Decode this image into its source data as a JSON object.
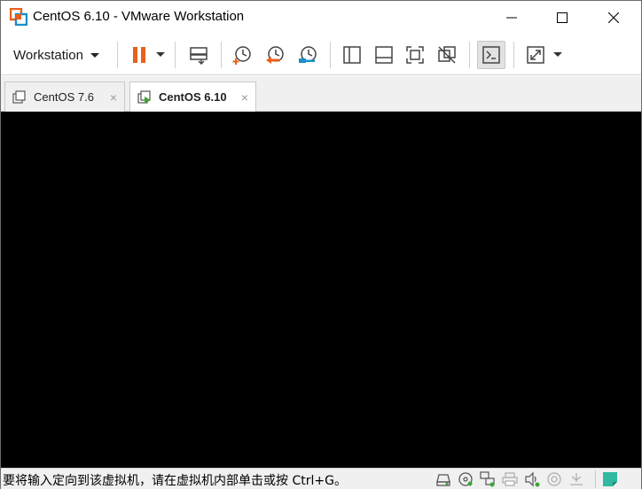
{
  "window": {
    "title": "CentOS 6.10 - VMware Workstation"
  },
  "toolbar": {
    "workstation_menu_label": "Workstation",
    "buttons": [
      {
        "name": "pause-icon",
        "label": "Pause"
      },
      {
        "name": "send-ctrl-alt-del-icon",
        "label": "Send Ctrl+Alt+Del"
      },
      {
        "name": "take-snapshot-icon",
        "label": "Take snapshot"
      },
      {
        "name": "revert-snapshot-icon",
        "label": "Revert snapshot"
      },
      {
        "name": "snapshot-manager-icon",
        "label": "Snapshot manager"
      },
      {
        "name": "show-library-icon",
        "label": "Library"
      },
      {
        "name": "show-thumbnail-bar-icon",
        "label": "Thumbnail bar"
      },
      {
        "name": "full-screen-icon",
        "label": "Full screen"
      },
      {
        "name": "unity-icon",
        "label": "Unity"
      },
      {
        "name": "console-view-icon",
        "label": "Console view"
      },
      {
        "name": "stretch-guest-icon",
        "label": "Stretch guest"
      }
    ],
    "colors": {
      "pause": "#e8601c",
      "snapshot_accent": "#e8601c",
      "manager_accent": "#1a8fc9"
    }
  },
  "tabs": [
    {
      "label": "CentOS 7.6",
      "active": false,
      "close": "×"
    },
    {
      "label": "CentOS 6.10",
      "active": true,
      "close": "×"
    }
  ],
  "console": {
    "background": "#000000"
  },
  "statusbar": {
    "message": "要将输入定向到该虚拟机，请在虚拟机内部单击或按 Ctrl+G。",
    "devices": [
      "hard-disk-icon",
      "cd-dvd-icon",
      "network-adapter-icon",
      "printer-icon",
      "sound-card-icon",
      "display-icon",
      "usb-icon",
      "message-log-icon"
    ],
    "message_log_color": "#2fb9a0"
  }
}
